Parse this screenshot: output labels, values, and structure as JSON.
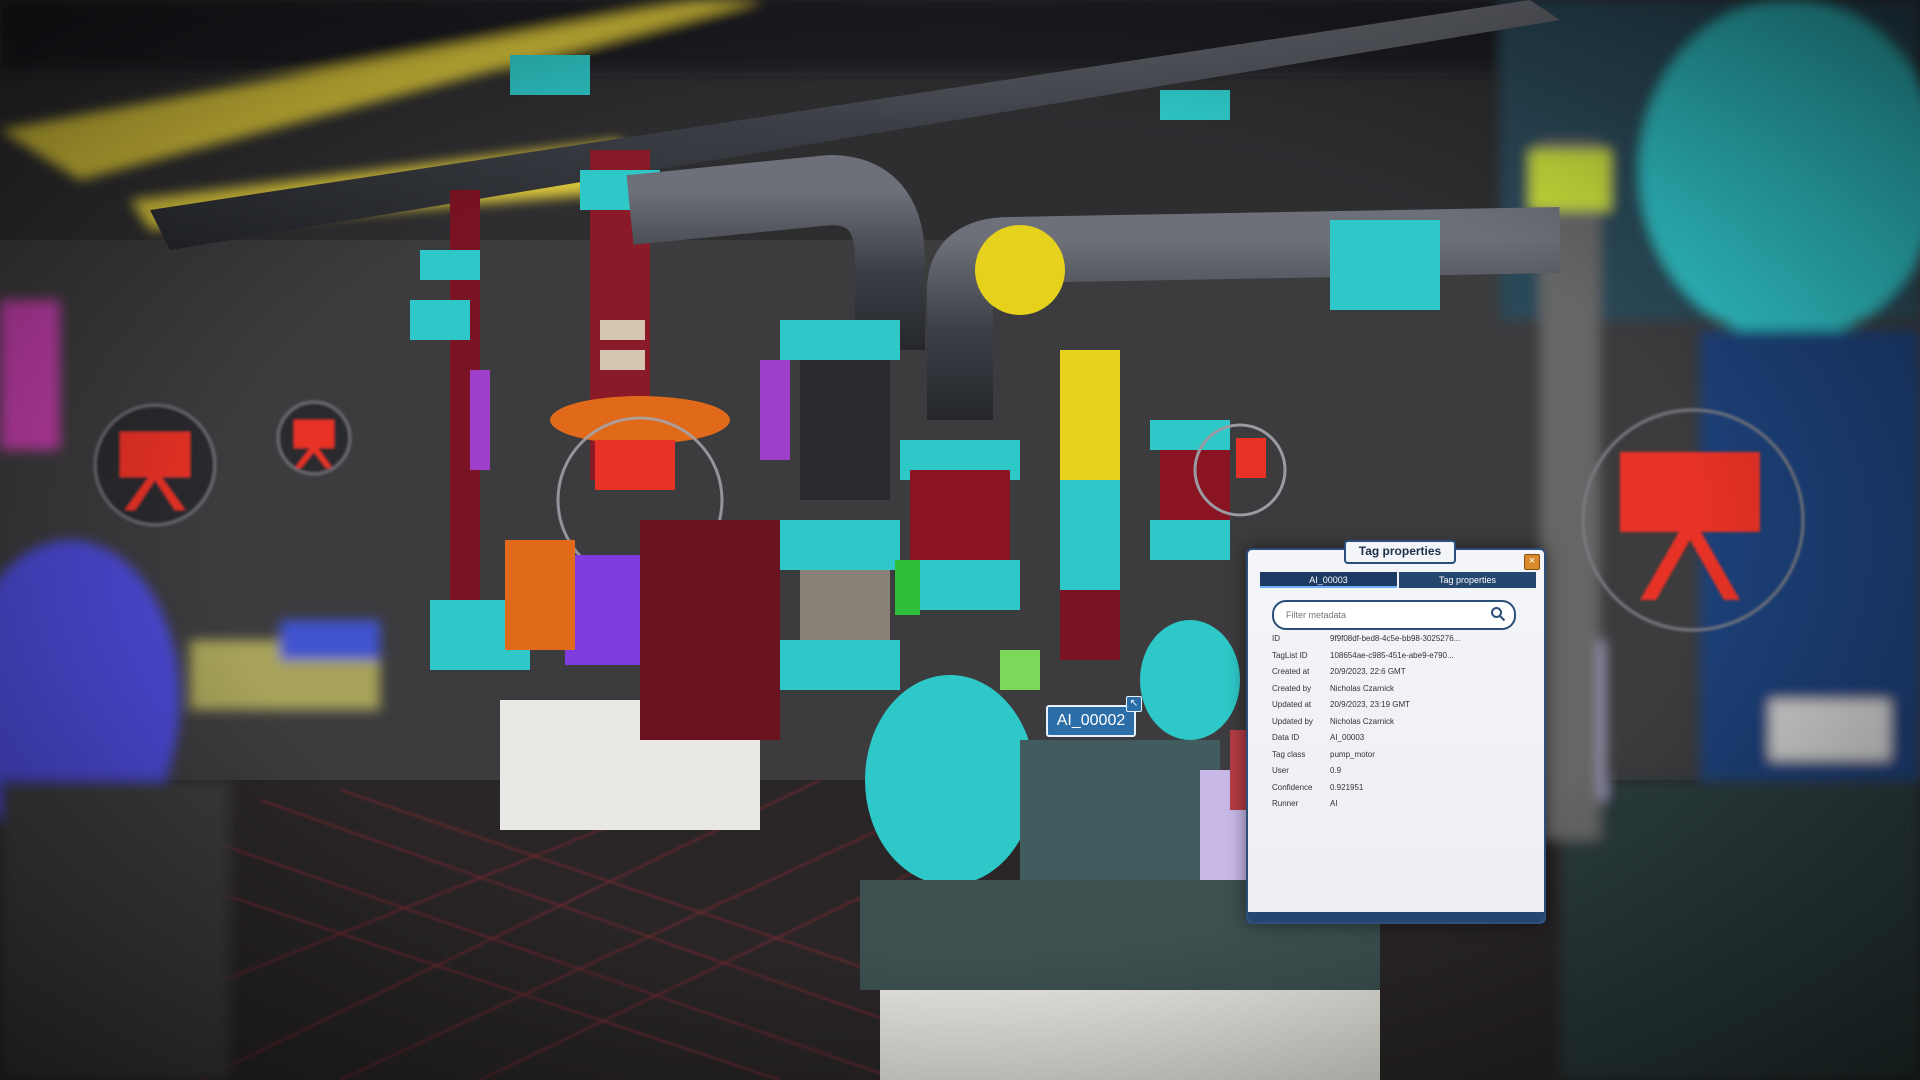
{
  "panel": {
    "title": "Tag properties",
    "close_label": "×",
    "tabs": [
      {
        "label": "AI_00003",
        "active": true
      },
      {
        "label": "Tag properties",
        "active": false
      }
    ],
    "search_placeholder": "Filter metadata",
    "properties": [
      {
        "key": "ID",
        "value": "9f9f08df-bed8-4c5e-bb98-3025276..."
      },
      {
        "key": "TagList ID",
        "value": "108654ae-c985-451e-abe9-e790..."
      },
      {
        "key": "Created at",
        "value": "20/9/2023, 22:6 GMT"
      },
      {
        "key": "Created by",
        "value": "Nicholas Czarnick"
      },
      {
        "key": "Updated at",
        "value": "20/9/2023, 23:19 GMT"
      },
      {
        "key": "Updated by",
        "value": "Nicholas Czarnick"
      },
      {
        "key": "Data ID",
        "value": "AI_00003"
      },
      {
        "key": "Tag class",
        "value": "pump_motor"
      },
      {
        "key": "User",
        "value": "0.9"
      },
      {
        "key": "Confidence",
        "value": "0.921951"
      },
      {
        "key": "Runner",
        "value": "AI"
      }
    ]
  },
  "ai_tag": {
    "label": "AI_00002",
    "icon": "pin-icon"
  },
  "colors": {
    "accent": "#2b4e7a",
    "cyan": "#2fc8c8",
    "red": "#e8322a",
    "magenta": "#9d3fc8",
    "yellow": "#e6d21c"
  }
}
